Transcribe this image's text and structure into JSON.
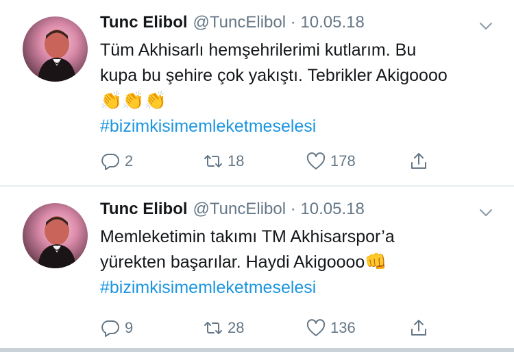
{
  "tweets": [
    {
      "author_name": "Tunc Elibol",
      "meta": "@TuncElibol · 10.05.18",
      "text": "Tüm Akhisarlı hemşehrilerimi kutlarım. Bu kupa bu şehire çok yakıştı. Tebrikler Akigoooo",
      "emoji": "👏👏👏",
      "hashtag": "#bizimkisimemleketmeselesi",
      "replies": "2",
      "retweets": "18",
      "likes": "178"
    },
    {
      "author_name": "Tunc Elibol",
      "meta": "@TuncElibol · 10.05.18",
      "text": "Memleketimin takımı TM Akhisarspor’a yürekten başarılar. Haydi Akigoooo",
      "emoji": "👊",
      "hashtag": "#bizimkisimemleketmeselesi",
      "replies": "9",
      "retweets": "28",
      "likes": "136"
    }
  ],
  "colors": {
    "text": "#14171a",
    "muted": "#657786",
    "link": "#1b95e0",
    "divider": "#e6ecf0"
  },
  "icons": [
    "reply-icon",
    "retweet-icon",
    "like-icon",
    "share-icon",
    "chevron-down-icon"
  ]
}
